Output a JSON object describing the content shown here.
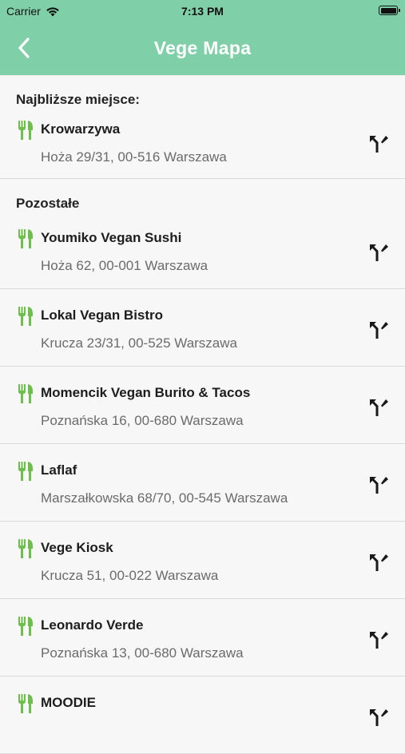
{
  "status": {
    "carrier": "Carrier",
    "time": "7:13 PM"
  },
  "header": {
    "title": "Vege Mapa"
  },
  "nearest": {
    "heading": "Najbliższe miejsce:",
    "place": {
      "name": "Krowarzywa",
      "address": "Hoża 29/31, 00-516 Warszawa"
    }
  },
  "others": {
    "heading": "Pozostałe",
    "places": [
      {
        "name": "Youmiko Vegan Sushi",
        "address": "Hoża 62, 00-001 Warszawa"
      },
      {
        "name": "Lokal Vegan Bistro",
        "address": "Krucza 23/31, 00-525 Warszawa"
      },
      {
        "name": "Momencik Vegan Burito & Tacos",
        "address": "Poznańska 16, 00-680 Warszawa"
      },
      {
        "name": "Laflaf",
        "address": "Marszałkowska 68/70, 00-545 Warszawa"
      },
      {
        "name": "Vege Kiosk",
        "address": "Krucza 51, 00-022 Warszawa"
      },
      {
        "name": "Leonardo Verde",
        "address": "Poznańska 13, 00-680 Warszawa"
      },
      {
        "name": "MOODIE",
        "address": ""
      }
    ]
  },
  "colors": {
    "accent": "#7fd0a8",
    "icon_green": "#6cc04a"
  }
}
